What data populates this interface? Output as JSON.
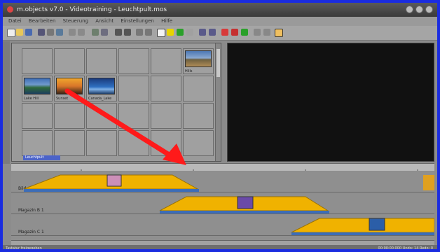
{
  "window": {
    "title": "m.objects v7.0 - Videotraining - Leuchtpult.mos"
  },
  "menu": [
    "Datei",
    "Bearbeiten",
    "Steuerung",
    "Ansicht",
    "Einstellungen",
    "Hilfe"
  ],
  "lightbox": {
    "thumbnails": [
      {
        "label": "Hills"
      },
      {
        "label": "Lake Hill"
      },
      {
        "label": "Sunset"
      },
      {
        "label": "Canada_Lake"
      }
    ],
    "tab_label": "Leuchtpult"
  },
  "tracks": [
    {
      "name": "Bild A"
    },
    {
      "name": "Magazin B 1"
    },
    {
      "name": "Magazin C 1"
    }
  ],
  "status": {
    "left": "Tastatur freigegeben",
    "right": "00:00:00.000  Undo: 14  Redo: 0"
  },
  "colors": {
    "frame_border": "#1a2ce0",
    "arrow": "#ff1a1a",
    "clip": "#f0b200",
    "preview": "#111111"
  }
}
